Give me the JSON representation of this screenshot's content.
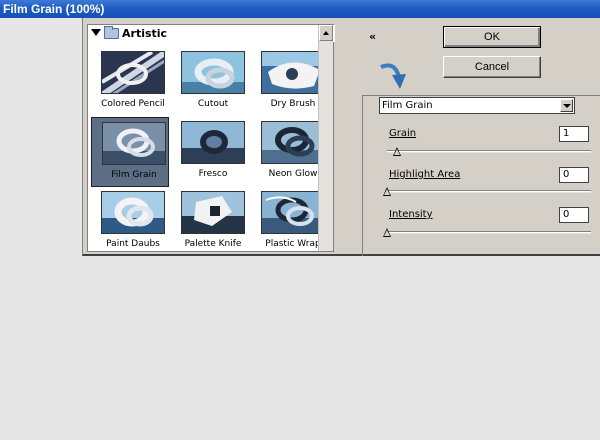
{
  "window": {
    "title": "Film Grain (100%)"
  },
  "browser": {
    "category": "Artistic",
    "filters": [
      {
        "label": "Colored Pencil"
      },
      {
        "label": "Cutout"
      },
      {
        "label": "Dry Brush"
      },
      {
        "label": "Film Grain",
        "selected": true
      },
      {
        "label": "Fresco"
      },
      {
        "label": "Neon Glow"
      },
      {
        "label": "Paint Daubs"
      },
      {
        "label": "Palette Knife"
      },
      {
        "label": "Plastic Wrap"
      }
    ]
  },
  "buttons": {
    "ok_label": "OK",
    "cancel_label": "Cancel",
    "collapse_label": "«"
  },
  "settings": {
    "selected_filter": "Film Grain",
    "params": [
      {
        "label": "Grain",
        "value": "1",
        "fraction": 0.05
      },
      {
        "label": "Highlight Area",
        "value": "0",
        "fraction": 0.0
      },
      {
        "label": "Intensity",
        "value": "0",
        "fraction": 0.0
      }
    ]
  },
  "colors": {
    "titlebar": "#1f5dc3",
    "dialog": "#d4d0c8",
    "selected_thumb": "#5c6f86"
  },
  "icons": [
    "triangle-down-icon",
    "folder-icon",
    "collapse-icon",
    "arrow-hint-icon",
    "dropdown-arrow-icon"
  ]
}
